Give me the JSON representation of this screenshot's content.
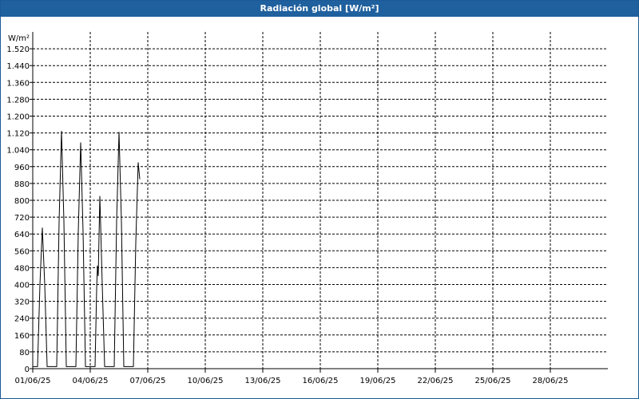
{
  "window": {
    "title": "Radiación global [W/m²]"
  },
  "chart_data": {
    "type": "line",
    "title": "Radiación global [W/m²]",
    "ylabel": "W/m²",
    "xlabel": "",
    "ylim": [
      0,
      1600
    ],
    "xlim": [
      "2025-06-01",
      "2025-07-01"
    ],
    "grid": true,
    "y_ticks": [
      0,
      80,
      160,
      240,
      320,
      400,
      480,
      560,
      640,
      720,
      800,
      880,
      960,
      1040,
      1120,
      1200,
      1280,
      1360,
      1440,
      1520
    ],
    "y_tick_labels": [
      "0",
      "80",
      "160",
      "240",
      "320",
      "400",
      "480",
      "560",
      "640",
      "720",
      "800",
      "880",
      "960",
      "1.040",
      "1.120",
      "1.200",
      "1.280",
      "1.360",
      "1.440",
      "1.520"
    ],
    "x_ticks": [
      "2025-06-01",
      "2025-06-04",
      "2025-06-07",
      "2025-06-10",
      "2025-06-13",
      "2025-06-16",
      "2025-06-19",
      "2025-06-22",
      "2025-06-25",
      "2025-06-28"
    ],
    "x_tick_labels": [
      "01/06/25",
      "04/06/25",
      "07/06/25",
      "10/06/25",
      "13/06/25",
      "16/06/25",
      "19/06/25",
      "22/06/25",
      "25/06/25",
      "28/06/25"
    ],
    "series": [
      {
        "color": "#000000",
        "x": [
          "2025-06-01 00:00",
          "2025-06-01 06:00",
          "2025-06-01 09:00",
          "2025-06-01 12:00",
          "2025-06-01 15:00",
          "2025-06-01 18:00",
          "2025-06-02 00:00",
          "2025-06-02 06:00",
          "2025-06-02 09:00",
          "2025-06-02 12:00",
          "2025-06-02 15:00",
          "2025-06-02 18:00",
          "2025-06-03 00:00",
          "2025-06-03 06:00",
          "2025-06-03 09:00",
          "2025-06-03 12:00",
          "2025-06-03 15:00",
          "2025-06-03 18:00",
          "2025-06-04 00:00",
          "2025-06-04 06:00",
          "2025-06-04 08:00",
          "2025-06-04 09:00",
          "2025-06-04 10:00",
          "2025-06-04 12:00",
          "2025-06-04 15:00",
          "2025-06-04 18:00",
          "2025-06-05 00:00",
          "2025-06-05 06:00",
          "2025-06-05 09:00",
          "2025-06-05 12:00",
          "2025-06-05 15:00",
          "2025-06-05 18:00",
          "2025-06-06 00:00",
          "2025-06-06 06:00",
          "2025-06-06 09:00",
          "2025-06-06 12:00",
          "2025-06-06 14:00"
        ],
        "values": [
          10,
          10,
          400,
          670,
          400,
          10,
          10,
          10,
          700,
          1130,
          700,
          10,
          10,
          10,
          650,
          1075,
          650,
          10,
          10,
          10,
          380,
          490,
          440,
          820,
          400,
          10,
          10,
          10,
          700,
          1125,
          700,
          10,
          10,
          10,
          600,
          980,
          900
        ]
      }
    ]
  }
}
